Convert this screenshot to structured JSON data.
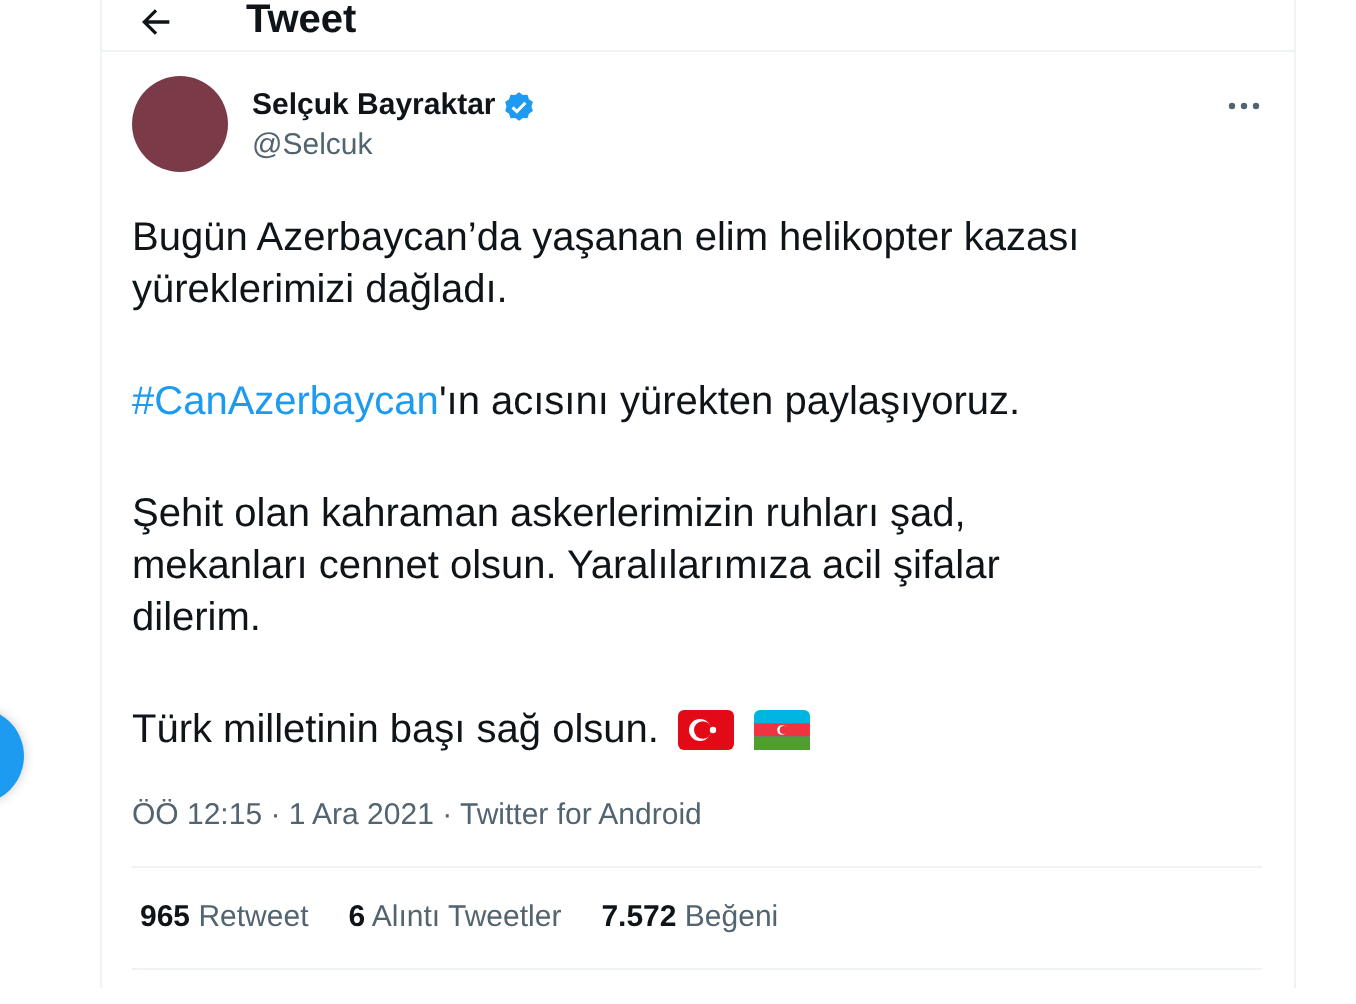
{
  "header": {
    "title": "Tweet"
  },
  "tweet": {
    "author": {
      "name": "Selçuk Bayraktar",
      "verified": true,
      "handle": "@Selcuk"
    },
    "paragraphs": [
      {
        "lines": [
          [
            {
              "kind": "text",
              "text": "Bugün Azerbaycan’da yaşanan elim helikopter kazası"
            }
          ],
          [
            {
              "kind": "text",
              "text": "yüreklerimizi dağladı."
            }
          ]
        ]
      },
      {
        "lines": [
          [
            {
              "kind": "hashtag",
              "text": "#CanAzerbaycan"
            },
            {
              "kind": "text",
              "text": "'ın acısını yürekten paylaşıyoruz."
            }
          ]
        ]
      },
      {
        "lines": [
          [
            {
              "kind": "text",
              "text": "Şehit olan kahraman askerlerimizin ruhları şad,"
            }
          ],
          [
            {
              "kind": "text",
              "text": "mekanları cennet olsun. Yaralılarımıza acil şifalar"
            }
          ],
          [
            {
              "kind": "text",
              "text": "dilerim."
            }
          ]
        ]
      },
      {
        "lines": [
          [
            {
              "kind": "text",
              "text": "Türk milletinin başı sağ olsun."
            }
          ]
        ]
      }
    ],
    "meta": "ÖÖ 12:15 · 1 Ara 2021 · Twitter for Android",
    "stats": [
      {
        "count": "965",
        "label": "Retweet"
      },
      {
        "count": "6",
        "label": "Alıntı Tweetler"
      },
      {
        "count": "7.572",
        "label": "Beğeni"
      }
    ]
  }
}
